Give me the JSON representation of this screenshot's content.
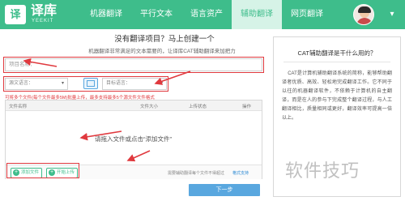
{
  "header": {
    "logo_mark": "译",
    "logo_title": "译库",
    "logo_sub": "YEEKIT",
    "nav": [
      {
        "label": "机器翻译"
      },
      {
        "label": "平行文本"
      },
      {
        "label": "语言资产"
      },
      {
        "label": "辅助翻译"
      },
      {
        "label": "网页翻译"
      }
    ],
    "user_caret": "▾"
  },
  "form": {
    "title": "没有翻译项目？马上创建一个",
    "desc": "机器翻译非常满足的文本需要的，让译库CAT辅助翻译来加把力",
    "name_placeholder": "项目名称：",
    "source_lang": "源文语言：",
    "target_lang": "目标语言：",
    "caret": "▾",
    "warning": "可将多个文件(每个文件最多5M)批量上传，最多支持最多5个源文件文件格式",
    "table_headers": [
      "文件名称",
      "文件大小",
      "上传状态",
      "操作"
    ],
    "drop_hint": "请拖入文件或点击“添加文件”",
    "add_file": "添加文件",
    "start_upload": "开始上传",
    "plus": "+",
    "footer_note": "需要辅助翻译每个文件不得超过",
    "footer_link": "格式支持",
    "next": "下一步"
  },
  "help": {
    "title": "CAT辅助翻译是干什么用的？",
    "body": "CAT是计算机辅助翻译系统的简称，能够帮助翻译者优质、高效、轻松地完成翻译工作。它不同于以往的机器翻译软件，不依赖于计算机的自主翻译，而是在人的参与下完成整个翻译过程，与人工翻译相比，质量相同或更好，翻译效率可提高一倍以上。"
  },
  "watermark": "软件技巧",
  "colors": {
    "brand": "#3ebd8b",
    "accent_blue": "#59a7df",
    "annotation_red": "#e0393e"
  }
}
